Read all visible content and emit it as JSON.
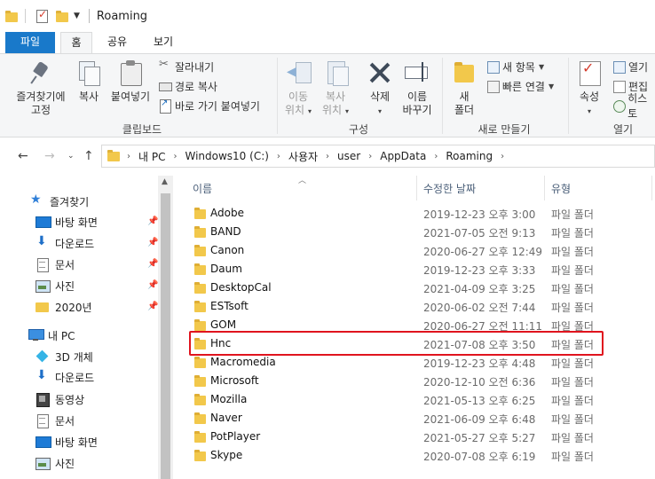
{
  "window": {
    "title": "Roaming"
  },
  "ribbon_tabs": [
    "파일",
    "홈",
    "공유",
    "보기"
  ],
  "ribbon": {
    "clipboard": {
      "pin": [
        "즐겨찾기에",
        "고정"
      ],
      "copy": "복사",
      "paste": "붙여넣기",
      "cut": "잘라내기",
      "copy_path": "경로 복사",
      "paste_shortcut": "바로 가기 붙여넣기",
      "label": "클립보드"
    },
    "organize": {
      "move_to": [
        "이동",
        "위치"
      ],
      "copy_to": [
        "복사",
        "위치"
      ],
      "delete": "삭제",
      "rename": [
        "이름",
        "바꾸기"
      ],
      "label": "구성"
    },
    "new": {
      "new_folder": [
        "새",
        "폴더"
      ],
      "new_item": "새 항목",
      "easy_access": "빠른 연결",
      "label": "새로 만들기"
    },
    "open": {
      "properties": "속성",
      "open": "열기",
      "edit": "편집",
      "history": "히스토",
      "label": "열기"
    }
  },
  "address": {
    "crumbs": [
      "내 PC",
      "Windows10 (C:)",
      "사용자",
      "user",
      "AppData",
      "Roaming"
    ]
  },
  "sidebar": {
    "items": [
      {
        "label": "즐겨찾기",
        "icon": "star-icon"
      },
      {
        "label": "바탕 화면",
        "icon": "desktop-icon",
        "pinned": true
      },
      {
        "label": "다운로드",
        "icon": "download-icon",
        "pinned": true
      },
      {
        "label": "문서",
        "icon": "document-icon",
        "pinned": true
      },
      {
        "label": "사진",
        "icon": "pictures-icon",
        "pinned": true
      },
      {
        "label": "2020년",
        "icon": "folder-icon",
        "pinned": true
      },
      {
        "label": "내 PC",
        "icon": "pc-icon"
      },
      {
        "label": "3D 개체",
        "icon": "3d-objects-icon"
      },
      {
        "label": "다운로드",
        "icon": "download-icon"
      },
      {
        "label": "동영상",
        "icon": "video-icon"
      },
      {
        "label": "문서",
        "icon": "document-icon"
      },
      {
        "label": "바탕 화면",
        "icon": "desktop-icon"
      },
      {
        "label": "사진",
        "icon": "pictures-icon"
      }
    ]
  },
  "columns": {
    "name": "이름",
    "date": "수정한 날짜",
    "type": "유형"
  },
  "files": [
    {
      "name": "Adobe",
      "date": "2019-12-23 오후 3:00",
      "type": "파일 폴더"
    },
    {
      "name": "BAND",
      "date": "2021-07-05 오전 9:13",
      "type": "파일 폴더"
    },
    {
      "name": "Canon",
      "date": "2020-06-27 오후 12:49",
      "type": "파일 폴더"
    },
    {
      "name": "Daum",
      "date": "2019-12-23 오후 3:33",
      "type": "파일 폴더"
    },
    {
      "name": "DesktopCal",
      "date": "2021-04-09 오후 3:25",
      "type": "파일 폴더"
    },
    {
      "name": "ESTsoft",
      "date": "2020-06-02 오전 7:44",
      "type": "파일 폴더"
    },
    {
      "name": "GOM",
      "date": "2020-06-27 오전 11:11",
      "type": "파일 폴더"
    },
    {
      "name": "Hnc",
      "date": "2021-07-08 오후 3:50",
      "type": "파일 폴더",
      "highlighted": true
    },
    {
      "name": "Macromedia",
      "date": "2019-12-23 오후 4:48",
      "type": "파일 폴더"
    },
    {
      "name": "Microsoft",
      "date": "2020-12-10 오전 6:36",
      "type": "파일 폴더"
    },
    {
      "name": "Mozilla",
      "date": "2021-05-13 오후 6:25",
      "type": "파일 폴더"
    },
    {
      "name": "Naver",
      "date": "2021-06-09 오후 6:48",
      "type": "파일 폴더"
    },
    {
      "name": "PotPlayer",
      "date": "2021-05-27 오후 5:27",
      "type": "파일 폴더"
    },
    {
      "name": "Skype",
      "date": "2020-07-08 오후 6:19",
      "type": "파일 폴더"
    }
  ],
  "colors": {
    "accent": "#1979ca",
    "highlight_box": "#e0141e",
    "folder": "#f2c84b"
  }
}
